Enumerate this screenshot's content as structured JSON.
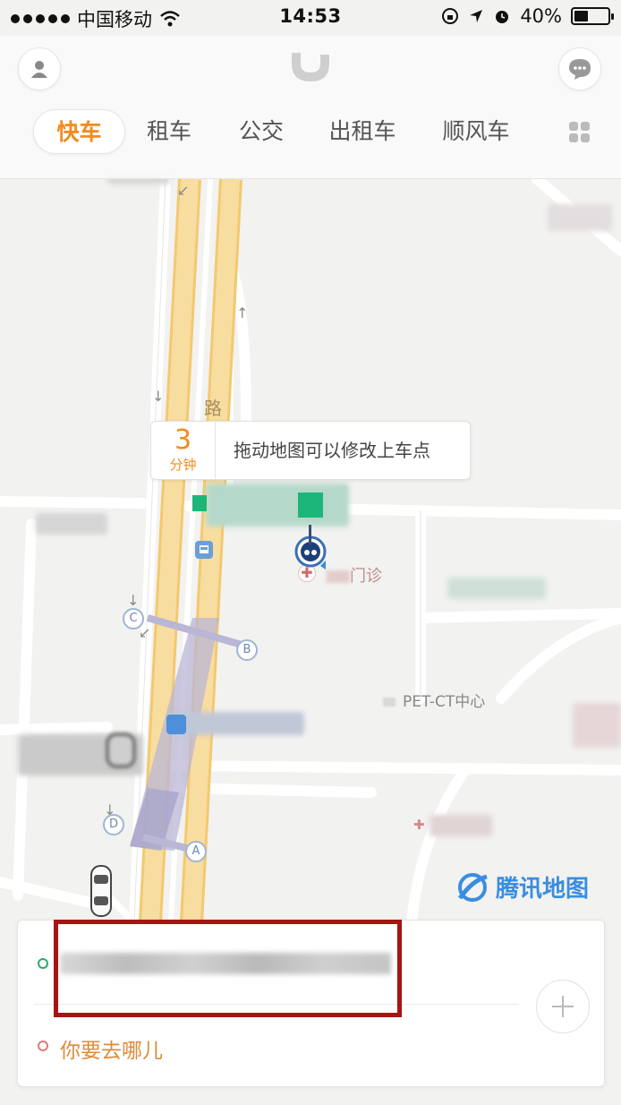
{
  "status_bar": {
    "carrier": "中国移动",
    "time": "14:53",
    "battery": "40%"
  },
  "header": {
    "tabs": [
      {
        "label": "快车"
      },
      {
        "label": "租车"
      },
      {
        "label": "公交"
      },
      {
        "label": "出租车"
      },
      {
        "label": "顺风车"
      }
    ]
  },
  "map": {
    "eta_value": "3",
    "eta_unit": "分钟",
    "callout_message": "拖动地图可以修改上车点",
    "poi_pet_ct": "PET-CT中心",
    "poi_clinic": "门诊",
    "road_name": "路",
    "metro_exits": [
      "A",
      "B",
      "C",
      "D"
    ],
    "attribution": "腾讯地图"
  },
  "trip": {
    "destination_placeholder": "你要去哪儿"
  },
  "colors": {
    "accent": "#f28b1d",
    "road": "#f7d98c",
    "pickup_dot": "#2eaa6c",
    "destination_dot": "#e07a7a",
    "highlight_box": "#a8140f"
  }
}
